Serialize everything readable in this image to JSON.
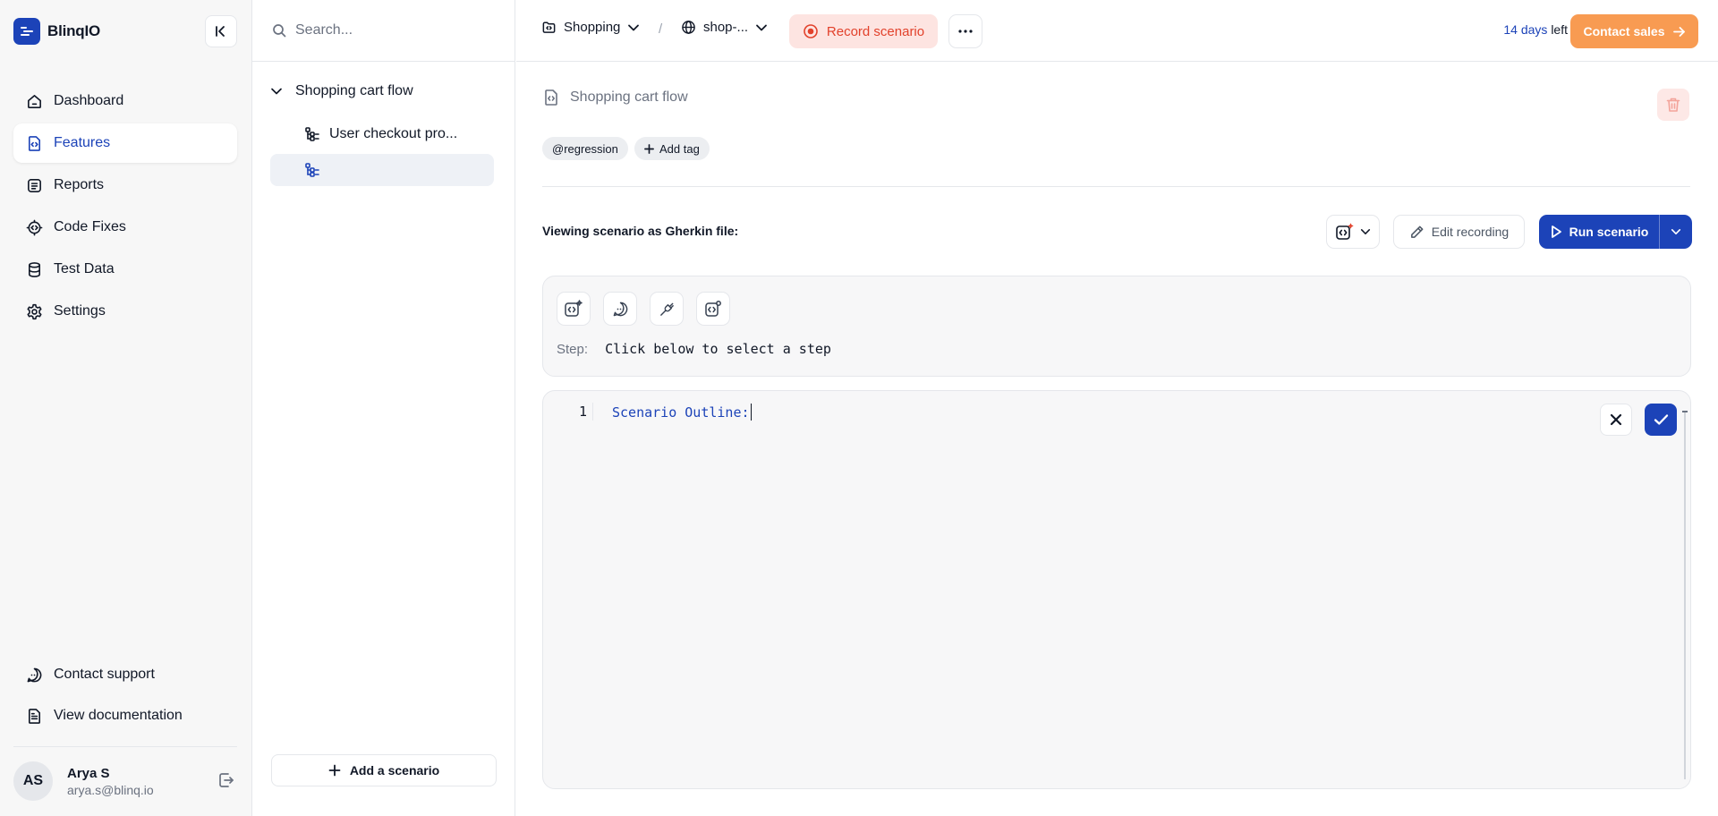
{
  "app": {
    "name": "BlinqIO"
  },
  "sidebar": {
    "items": [
      {
        "label": "Dashboard",
        "icon": "home-icon"
      },
      {
        "label": "Features",
        "icon": "features-icon",
        "active": true
      },
      {
        "label": "Reports",
        "icon": "reports-icon"
      },
      {
        "label": "Code Fixes",
        "icon": "code-fixes-icon"
      },
      {
        "label": "Test Data",
        "icon": "database-icon"
      },
      {
        "label": "Settings",
        "icon": "gear-icon"
      }
    ],
    "bottom_items": [
      {
        "label": "Contact support",
        "icon": "chat-icon"
      },
      {
        "label": "View documentation",
        "icon": "document-icon"
      }
    ],
    "user": {
      "initials": "AS",
      "name": "Arya S",
      "email": "arya.s@blinq.io"
    }
  },
  "search": {
    "placeholder": "Search..."
  },
  "tree": {
    "feature": "Shopping cart flow",
    "scenarios": [
      {
        "label": "User checkout pro..."
      },
      {
        "label": ""
      }
    ],
    "add_label": "Add a scenario"
  },
  "topbar": {
    "project": "Shopping",
    "environment": "shop-...",
    "separator": "/",
    "record_label": "Record scenario",
    "trial_days": "14 days",
    "trial_suffix": "left",
    "contact_label": "Contact sales"
  },
  "feature": {
    "title": "Shopping cart flow",
    "tags": [
      "@regression"
    ],
    "add_tag_label": "Add tag"
  },
  "scenario_view": {
    "viewing_label": "Viewing scenario as Gherkin file:",
    "edit_label": "Edit recording",
    "run_label": "Run scenario",
    "step_label": "Step:",
    "step_text": "Click below to select a step"
  },
  "editor": {
    "lines": [
      {
        "number": "1",
        "text": "Scenario Outline:"
      }
    ]
  },
  "colors": {
    "accent": "#1c43b8",
    "record": "#e2412b",
    "record_bg": "#fde4e1",
    "contact": "#f89b52"
  }
}
